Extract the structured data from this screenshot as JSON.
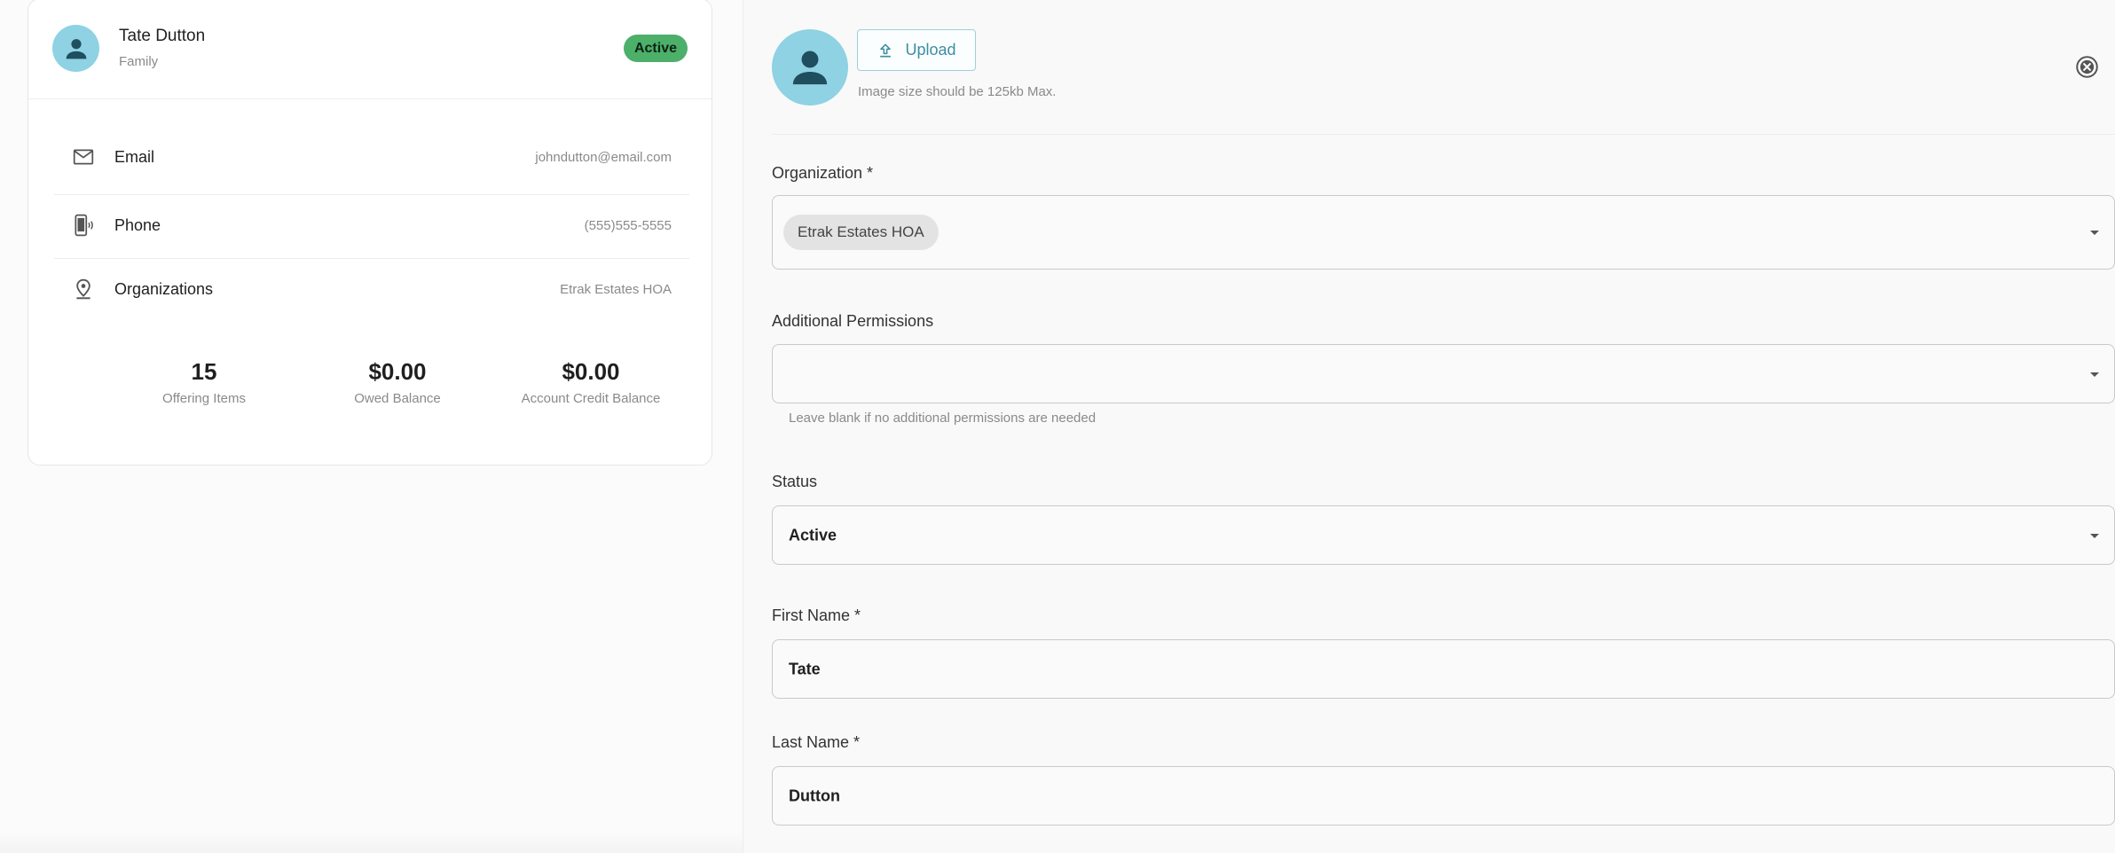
{
  "profile": {
    "name": "Tate Dutton",
    "role": "Family",
    "status": "Active",
    "info": [
      {
        "label": "Email",
        "value": "johndutton@email.com",
        "icon": "mail-icon"
      },
      {
        "label": "Phone",
        "value": "(555)555-5555",
        "icon": "phone-icon"
      },
      {
        "label": "Organizations",
        "value": "Etrak Estates HOA",
        "icon": "location-pin-icon"
      }
    ],
    "stats": [
      {
        "value": "15",
        "label": "Offering Items"
      },
      {
        "value": "$0.00",
        "label": "Owed Balance"
      },
      {
        "value": "$0.00",
        "label": "Account Credit Balance"
      }
    ]
  },
  "form": {
    "upload_label": "Upload",
    "upload_hint": "Image size should be 125kb Max.",
    "organization": {
      "label": "Organization *",
      "chip": "Etrak Estates HOA"
    },
    "permissions": {
      "label": "Additional Permissions",
      "value": "",
      "helper": "Leave blank if no additional permissions are needed"
    },
    "status": {
      "label": "Status",
      "value": "Active"
    },
    "first_name": {
      "label": "First Name *",
      "value": "Tate"
    },
    "last_name": {
      "label": "Last Name *",
      "value": "Dutton"
    }
  },
  "colors": {
    "avatar": "#8ed2e3",
    "avatar_figure": "#1f4e5f",
    "badge": "#4caf6a",
    "upload_accent": "#3c8ea2"
  }
}
